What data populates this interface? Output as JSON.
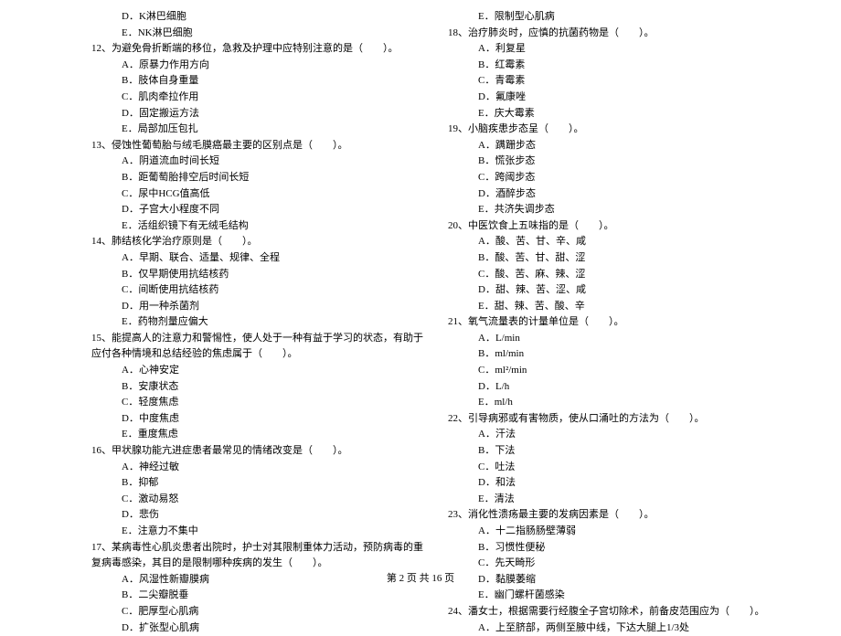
{
  "col1": {
    "pre_options": [
      "D．K淋巴细胞",
      "E．NK淋巴细胞"
    ],
    "q12": {
      "stem": "12、为避免骨折断端的移位，急救及护理中应特别注意的是（　　）。",
      "opts": [
        "A．原暴力作用方向",
        "B．肢体自身重量",
        "C．肌肉牵拉作用",
        "D．固定搬运方法",
        "E．局部加压包扎"
      ]
    },
    "q13": {
      "stem": "13、侵蚀性葡萄胎与绒毛膜癌最主要的区别点是（　　）。",
      "opts": [
        "A．阴道流血时间长短",
        "B．距葡萄胎排空后时间长短",
        "C．尿中HCG值高低",
        "D．子宫大小程度不同",
        "E．活组织镜下有无绒毛结构"
      ]
    },
    "q14": {
      "stem": "14、肺结核化学治疗原则是（　　）。",
      "opts": [
        "A．早期、联合、适量、规律、全程",
        "B．仅早期使用抗结核药",
        "C．间断使用抗结核药",
        "D．用一种杀菌剂",
        "E．药物剂量应偏大"
      ]
    },
    "q15": {
      "stem": "15、能提高人的注意力和警惕性，使人处于一种有益于学习的状态，有助于应付各种情境和总结经验的焦虑属于（　　）。",
      "opts": [
        "A．心神安定",
        "B．安康状态",
        "C．轻度焦虑",
        "D．中度焦虑",
        "E．重度焦虑"
      ]
    },
    "q16": {
      "stem": "16、甲状腺功能亢进症患者最常见的情绪改变是（　　）。",
      "opts": [
        "A．神经过敏",
        "B．抑郁",
        "C．激动易怒",
        "D．悲伤",
        "E．注意力不集中"
      ]
    },
    "q17": {
      "stem": "17、某病毒性心肌炎患者出院时，护士对其限制重体力活动，预防病毒的重复病毒感染，其目的是限制哪种疾病的发生（　　）。",
      "opts": [
        "A．风湿性新瓣膜病",
        "B．二尖瓣脱垂",
        "C．肥厚型心肌病",
        "D．扩张型心肌病"
      ]
    }
  },
  "col2": {
    "pre_options": [
      "E．限制型心肌病"
    ],
    "q18": {
      "stem": "18、治疗肺炎时，应慎的抗菌药物是（　　）。",
      "opts": [
        "A．利复星",
        "B．红霉素",
        "C．青霉素",
        "D．氟康唑",
        "E．庆大霉素"
      ]
    },
    "q19": {
      "stem": "19、小脑疾患步态呈（　　）。",
      "opts": [
        "A．蹒跚步态",
        "B．慌张步态",
        "C．跨阈步态",
        "D．酒醉步态",
        "E．共济失调步态"
      ]
    },
    "q20": {
      "stem": "20、中医饮食上五味指的是（　　）。",
      "opts": [
        "A．酸、苦、甘、辛、咸",
        "B．酸、苦、甘、甜、涩",
        "C．酸、苦、麻、辣、涩",
        "D．甜、辣、苦、涩、咸",
        "E．甜、辣、苦、酸、辛"
      ]
    },
    "q21": {
      "stem": "21、氧气流量表的计量单位是（　　）。",
      "opts": [
        "A．L/min",
        "B．ml/min",
        "C．ml²/min",
        "D．L/h",
        "E．ml/h"
      ]
    },
    "q22": {
      "stem": "22、引导病邪或有害物质，使从口涌吐的方法为（　　）。",
      "opts": [
        "A．汗法",
        "B．下法",
        "C．吐法",
        "D．和法",
        "E．清法"
      ]
    },
    "q23": {
      "stem": "23、消化性溃疡最主要的发病因素是（　　）。",
      "opts": [
        "A．十二指肠肠壁薄弱",
        "B．习惯性便秘",
        "C．先天畸形",
        "D．黏膜萎缩",
        "E．幽门螺杆菌感染"
      ]
    },
    "q24": {
      "stem": "24、潘女士，根据需要行经腹全子宫切除术，前备皮范围应为（　　）。",
      "opts": [
        "A．上至脐部，两侧至腋中线，下达大腿上1/3处"
      ]
    }
  },
  "footer": "第 2 页 共 16 页"
}
